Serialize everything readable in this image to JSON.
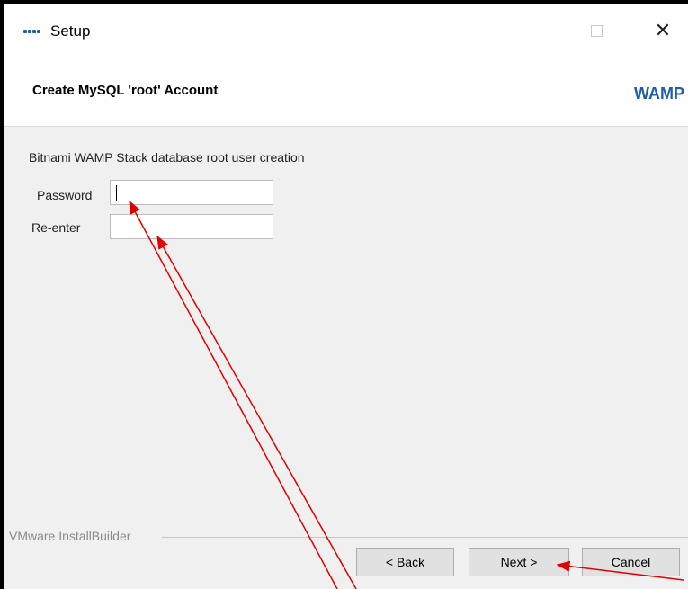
{
  "window": {
    "title": "Setup",
    "controls": {
      "minimize": "—",
      "maximize": "",
      "close": "✕"
    }
  },
  "header": {
    "title": "Create MySQL 'root' Account",
    "brand": "WAMP"
  },
  "form": {
    "description": "Bitnami WAMP Stack database root user creation",
    "password_label": "Password",
    "password_value": "",
    "reenter_label": "Re-enter",
    "reenter_value": ""
  },
  "footer": {
    "installer_label": "VMware InstallBuilder",
    "back_label": "< Back",
    "next_label": "Next >",
    "cancel_label": "Cancel"
  },
  "colors": {
    "annotation": "#e00000",
    "brand": "#1f5fa8"
  }
}
